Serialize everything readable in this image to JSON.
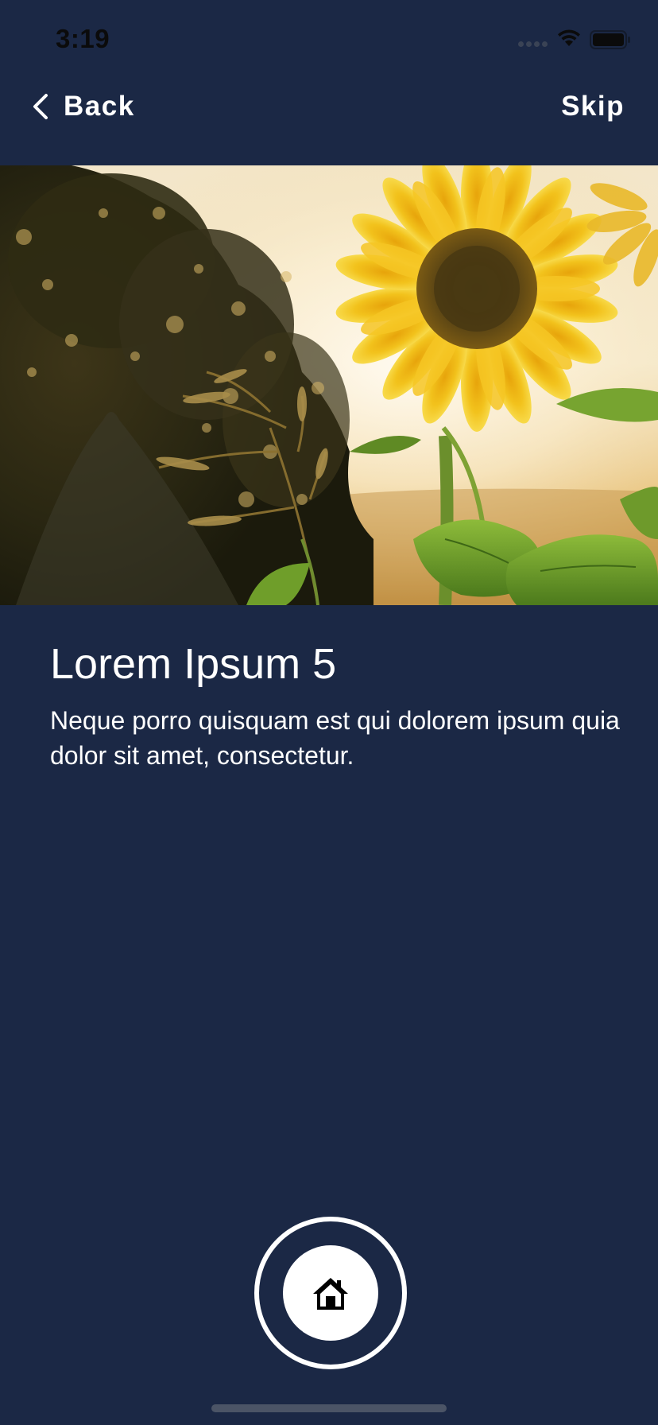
{
  "status_bar": {
    "time": "3:19"
  },
  "nav": {
    "back_label": "Back",
    "skip_label": "Skip"
  },
  "content": {
    "title": "Lorem Ipsum 5",
    "body": "Neque porro quisquam est qui dolorem ipsum quia dolor sit amet, consectetur."
  },
  "icons": {
    "back": "chevron-left-icon",
    "home": "home-icon",
    "wifi": "wifi-icon",
    "battery": "battery-icon"
  },
  "colors": {
    "background": "#1b2845",
    "text": "#ffffff",
    "home_button": "#ffffff"
  }
}
